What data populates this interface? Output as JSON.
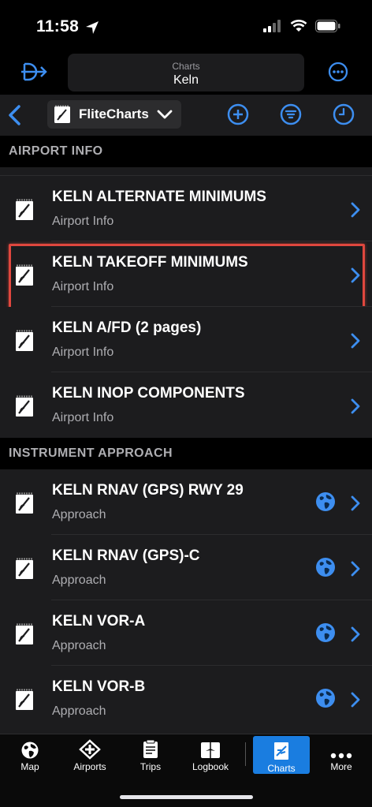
{
  "status_bar": {
    "time": "11:58"
  },
  "title_bar": {
    "subtitle": "Charts",
    "title": "Keln"
  },
  "toolbar": {
    "source_label": "FliteCharts"
  },
  "sections": [
    {
      "header": "AIRPORT INFO",
      "rows": [
        {
          "title": "KELN ALTERNATE MINIMUMS",
          "subtitle": "Airport Info"
        },
        {
          "title": "KELN TAKEOFF MINIMUMS",
          "subtitle": "Airport Info"
        },
        {
          "title": "KELN A/FD (2 pages)",
          "subtitle": "Airport Info"
        },
        {
          "title": "KELN INOP COMPONENTS",
          "subtitle": "Airport Info"
        }
      ]
    },
    {
      "header": "INSTRUMENT APPROACH",
      "rows": [
        {
          "title": "KELN RNAV (GPS) RWY 29",
          "subtitle": "Approach"
        },
        {
          "title": "KELN RNAV (GPS)-C",
          "subtitle": "Approach"
        },
        {
          "title": "KELN VOR-A",
          "subtitle": "Approach"
        },
        {
          "title": "KELN VOR-B",
          "subtitle": "Approach"
        }
      ]
    }
  ],
  "tab_bar": {
    "tabs": [
      {
        "label": "Map",
        "icon": "globe-icon"
      },
      {
        "label": "Airports",
        "icon": "airport-icon"
      },
      {
        "label": "Trips",
        "icon": "trips-icon"
      },
      {
        "label": "Logbook",
        "icon": "logbook-icon"
      },
      {
        "label": "Charts",
        "icon": "charts-icon",
        "active": true
      },
      {
        "label": "More",
        "icon": "more-icon"
      }
    ]
  },
  "colors": {
    "accent": "#3d8ef0",
    "highlight": "#e0473e",
    "active_tab": "#1a7de0"
  }
}
